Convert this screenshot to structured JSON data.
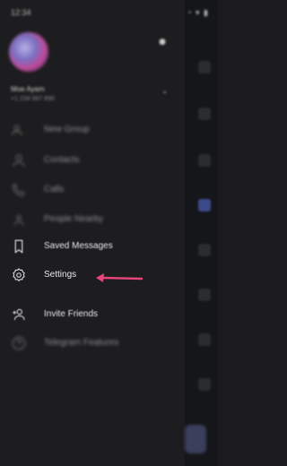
{
  "status_bar": {
    "time": "12:34",
    "indicators": "◔ ▾ ▮"
  },
  "drawer": {
    "profile": {
      "name": "Moe Ayam",
      "phone": "+1 234 567 890"
    },
    "menu": [
      {
        "label": "New Group",
        "icon": "group-icon"
      },
      {
        "label": "Contacts",
        "icon": "person-icon"
      },
      {
        "label": "Calls",
        "icon": "phone-icon"
      },
      {
        "label": "People Nearby",
        "icon": "people-nearby-icon"
      },
      {
        "label": "Saved Messages",
        "icon": "bookmark-icon"
      },
      {
        "label": "Settings",
        "icon": "gear-icon"
      },
      {
        "label": "Invite Friends",
        "icon": "add-person-icon"
      },
      {
        "label": "Telegram Features",
        "icon": "question-icon"
      }
    ]
  },
  "annotation": {
    "color": "#e8457a"
  }
}
